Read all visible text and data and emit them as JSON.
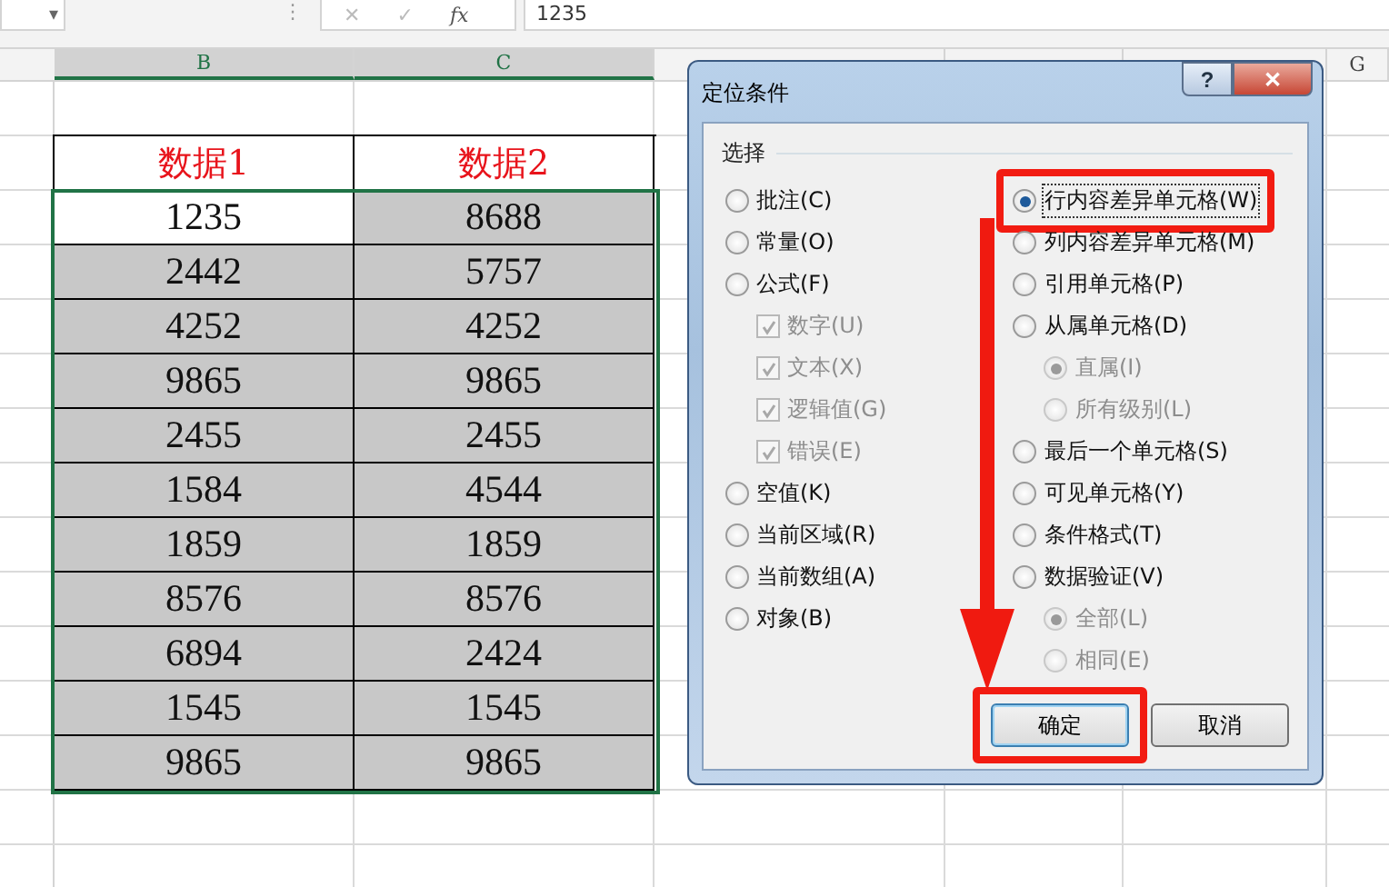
{
  "formula_bar": {
    "caret": "▾",
    "separator": "⋮",
    "cancel": "✕",
    "enter": "✓",
    "fx": "fx",
    "value": "1235"
  },
  "sheet": {
    "columns": [
      "B",
      "C",
      "G"
    ],
    "header_row": [
      {
        "text": "数据1"
      },
      {
        "text": "数据2"
      }
    ],
    "rows": [
      [
        {
          "text": "1235",
          "selected": false
        },
        {
          "text": "8688",
          "selected": true
        }
      ],
      [
        {
          "text": "2442",
          "selected": true
        },
        {
          "text": "5757",
          "selected": true
        }
      ],
      [
        {
          "text": "4252",
          "selected": true
        },
        {
          "text": "4252",
          "selected": true
        }
      ],
      [
        {
          "text": "9865",
          "selected": true
        },
        {
          "text": "9865",
          "selected": true
        }
      ],
      [
        {
          "text": "2455",
          "selected": true
        },
        {
          "text": "2455",
          "selected": true
        }
      ],
      [
        {
          "text": "1584",
          "selected": true
        },
        {
          "text": "4544",
          "selected": true
        }
      ],
      [
        {
          "text": "1859",
          "selected": true
        },
        {
          "text": "1859",
          "selected": true
        }
      ],
      [
        {
          "text": "8576",
          "selected": true
        },
        {
          "text": "8576",
          "selected": true
        }
      ],
      [
        {
          "text": "6894",
          "selected": true
        },
        {
          "text": "2424",
          "selected": true
        }
      ],
      [
        {
          "text": "1545",
          "selected": true
        },
        {
          "text": "1545",
          "selected": true
        }
      ],
      [
        {
          "text": "9865",
          "selected": true
        },
        {
          "text": "9865",
          "selected": true
        }
      ]
    ]
  },
  "dialog": {
    "title": "定位条件",
    "help": "?",
    "close": "✕",
    "group": "选择",
    "left": [
      {
        "kind": "radio",
        "label": "批注(C)",
        "selected": false,
        "disabled": false
      },
      {
        "kind": "radio",
        "label": "常量(O)",
        "selected": false,
        "disabled": false
      },
      {
        "kind": "radio",
        "label": "公式(F)",
        "selected": false,
        "disabled": false,
        "children": [
          {
            "kind": "check",
            "label": "数字(U)",
            "checked": true,
            "disabled": true
          },
          {
            "kind": "check",
            "label": "文本(X)",
            "checked": true,
            "disabled": true
          },
          {
            "kind": "check",
            "label": "逻辑值(G)",
            "checked": true,
            "disabled": true
          },
          {
            "kind": "check",
            "label": "错误(E)",
            "checked": true,
            "disabled": true
          }
        ]
      },
      {
        "kind": "radio",
        "label": "空值(K)",
        "selected": false,
        "disabled": false
      },
      {
        "kind": "radio",
        "label": "当前区域(R)",
        "selected": false,
        "disabled": false
      },
      {
        "kind": "radio",
        "label": "当前数组(A)",
        "selected": false,
        "disabled": false
      },
      {
        "kind": "radio",
        "label": "对象(B)",
        "selected": false,
        "disabled": false
      }
    ],
    "right": [
      {
        "kind": "radio",
        "label": "行内容差异单元格(W)",
        "selected": true,
        "disabled": false,
        "highlighted": true
      },
      {
        "kind": "radio",
        "label": "列内容差异单元格(M)",
        "selected": false,
        "disabled": false
      },
      {
        "kind": "radio",
        "label": "引用单元格(P)",
        "selected": false,
        "disabled": false
      },
      {
        "kind": "radio",
        "label": "从属单元格(D)",
        "selected": false,
        "disabled": false,
        "children": [
          {
            "kind": "radio",
            "label": "直属(I)",
            "selected": true,
            "disabled": true
          },
          {
            "kind": "radio",
            "label": "所有级别(L)",
            "selected": false,
            "disabled": true
          }
        ]
      },
      {
        "kind": "radio",
        "label": "最后一个单元格(S)",
        "selected": false,
        "disabled": false
      },
      {
        "kind": "radio",
        "label": "可见单元格(Y)",
        "selected": false,
        "disabled": false
      },
      {
        "kind": "radio",
        "label": "条件格式(T)",
        "selected": false,
        "disabled": false
      },
      {
        "kind": "radio",
        "label": "数据验证(V)",
        "selected": false,
        "disabled": false,
        "children": [
          {
            "kind": "radio",
            "label": "全部(L)",
            "selected": true,
            "disabled": true
          },
          {
            "kind": "radio",
            "label": "相同(E)",
            "selected": false,
            "disabled": true
          }
        ]
      }
    ],
    "buttons": [
      {
        "label": "确定",
        "highlighted": true
      },
      {
        "label": "取消"
      }
    ]
  }
}
